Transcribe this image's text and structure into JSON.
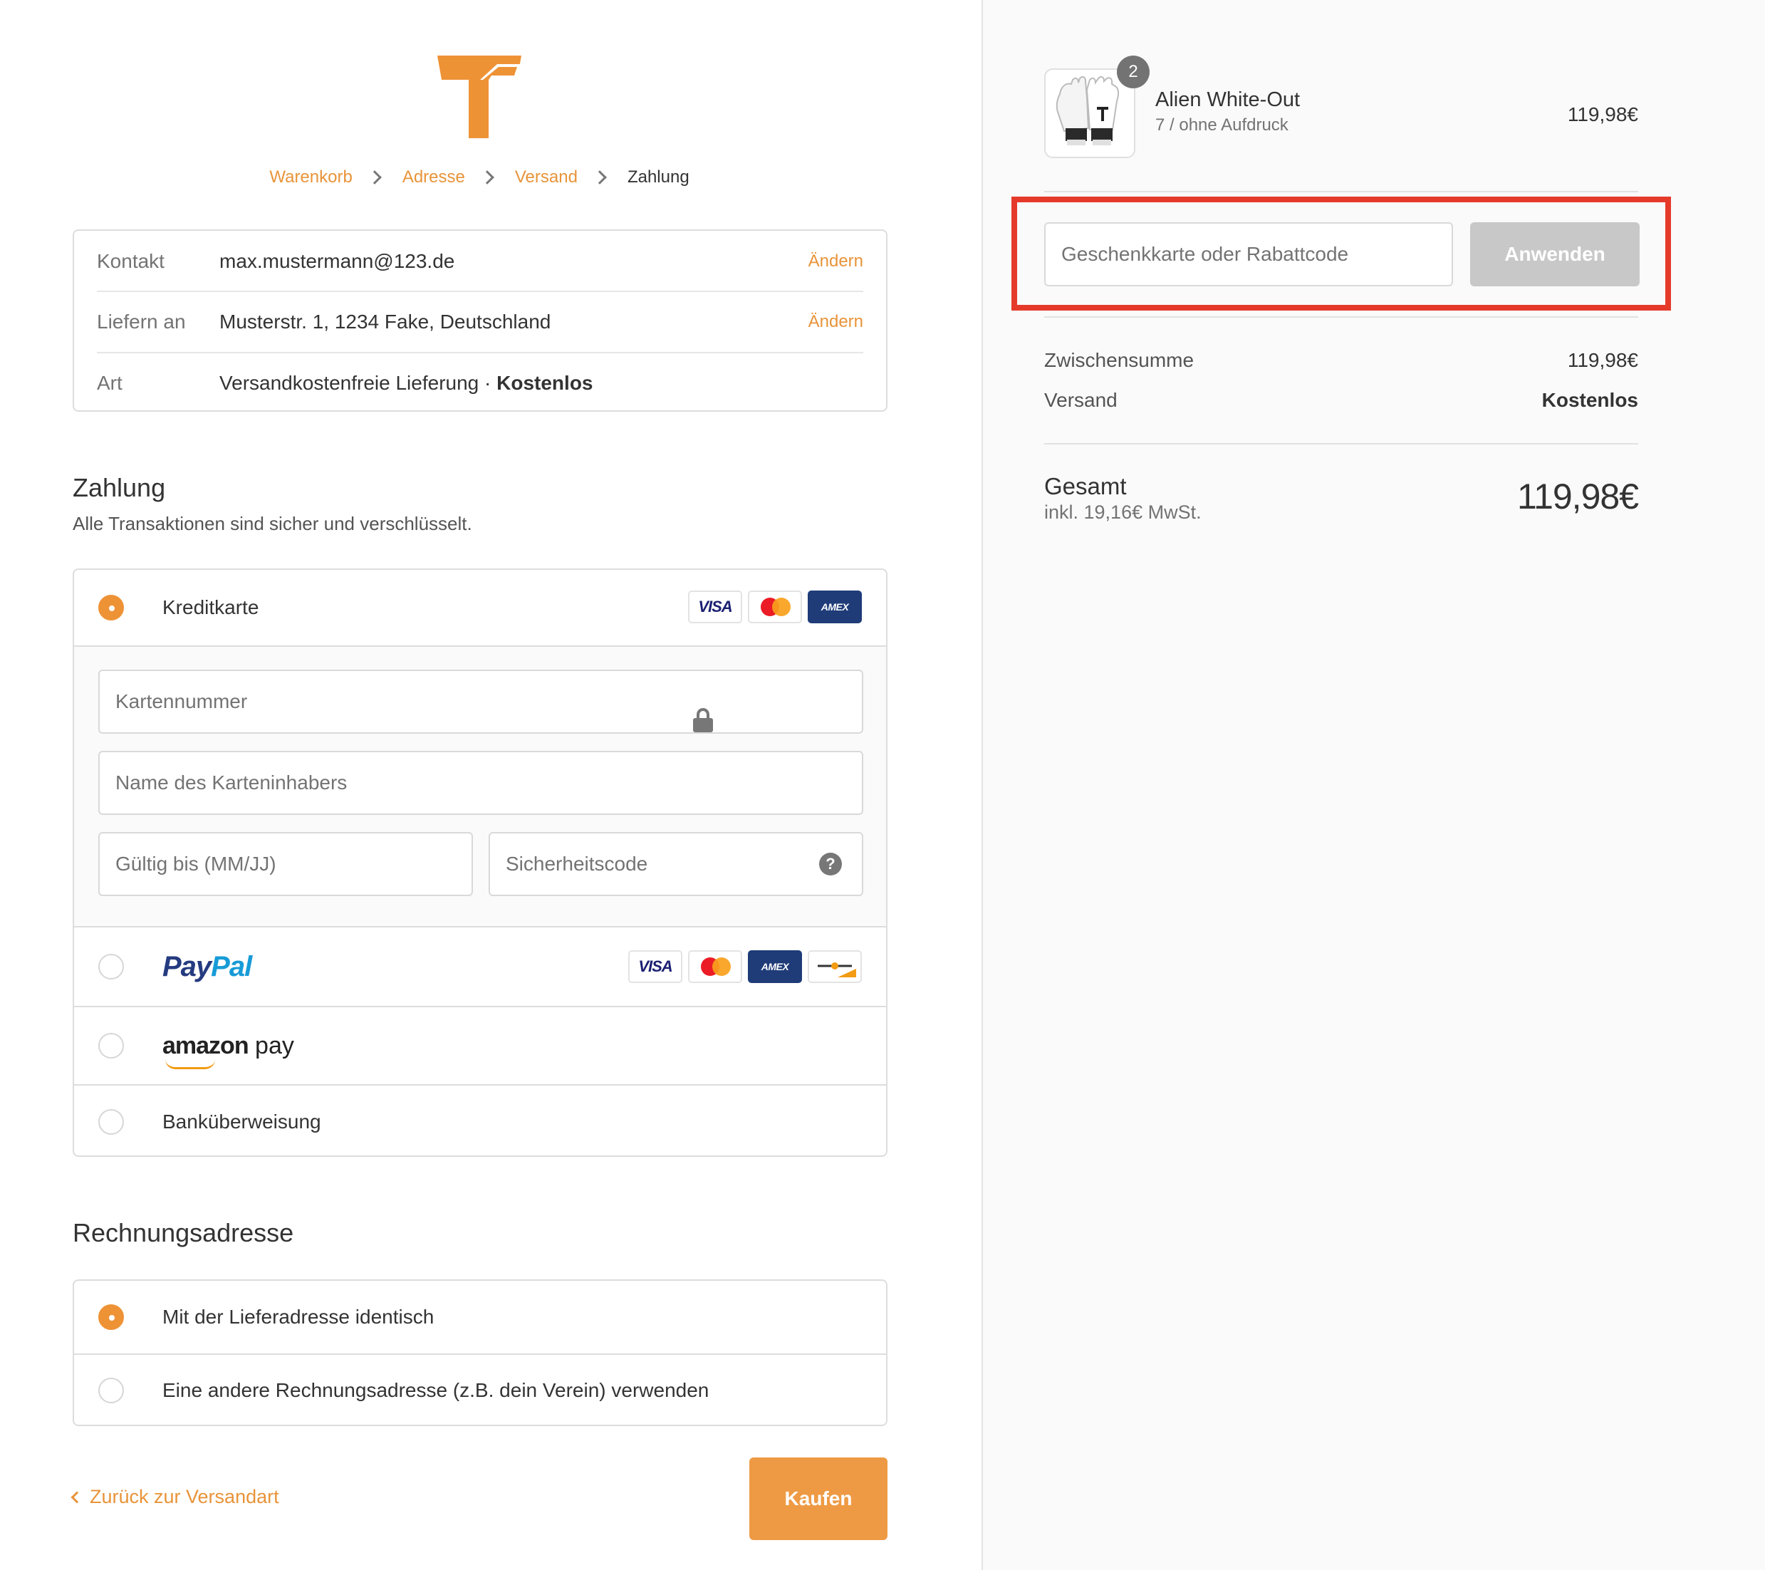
{
  "breadcrumb": [
    {
      "label": "Warenkorb"
    },
    {
      "label": "Adresse"
    },
    {
      "label": "Versand"
    },
    {
      "label": "Zahlung"
    }
  ],
  "summary": {
    "contact": {
      "label": "Kontakt",
      "value": "max.mustermann@123.de",
      "change": "Ändern"
    },
    "ship_to": {
      "label": "Liefern an",
      "value": "Musterstr. 1, 1234 Fake, Deutschland",
      "change": "Ändern"
    },
    "method": {
      "label": "Art",
      "value": "Versandkostenfreie Lieferung · ",
      "value_bold": "Kostenlos"
    }
  },
  "payment": {
    "title": "Zahlung",
    "subtitle": "Alle Transaktionen sind sicher und verschlüsselt.",
    "credit_card": {
      "label": "Kreditkarte",
      "card_number_placeholder": "Kartennummer",
      "holder_placeholder": "Name des Karteninhabers",
      "expiry_placeholder": "Gültig bis (MM/JJ)",
      "cvc_placeholder": "Sicherheitscode",
      "cvc_help": "?"
    },
    "paypal": {
      "logo_a": "Pay",
      "logo_b": "Pal"
    },
    "amazon": {
      "logo_a": "amazon",
      "logo_b": " pay"
    },
    "bank": {
      "label": "Banküberweisung"
    },
    "card_brands": {
      "visa": "VISA",
      "amex": "AMEX"
    }
  },
  "billing": {
    "title": "Rechnungsadresse",
    "same": "Mit der Lieferadresse identisch",
    "other": "Eine andere Rechnungsadresse (z.B. dein Verein) verwenden"
  },
  "nav": {
    "back": "Zurück zur Versandart",
    "buy": "Kaufen"
  },
  "order": {
    "item": {
      "quantity": "2",
      "name": "Alien White-Out",
      "variant": "7 / ohne Aufdruck",
      "price": "119,98€"
    },
    "discount": {
      "placeholder": "Geschenkkarte oder Rabattcode",
      "apply": "Anwenden"
    },
    "subtotal": {
      "label": "Zwischensumme",
      "value": "119,98€"
    },
    "shipping": {
      "label": "Versand",
      "value": "Kostenlos"
    },
    "total": {
      "label": "Gesamt",
      "tax": "inkl. 19,16€ MwSt.",
      "value": "119,98€"
    }
  },
  "colors": {
    "accent": "#ee9236",
    "highlight": "#e53a2a",
    "disabled_button": "#c8c8c8"
  }
}
